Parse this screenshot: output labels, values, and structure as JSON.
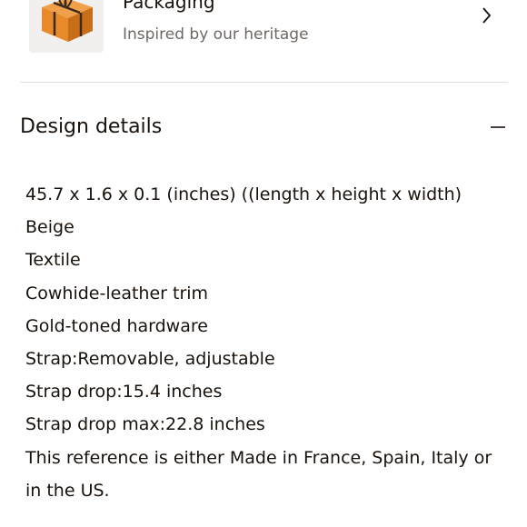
{
  "packaging": {
    "title": "Packaging",
    "subtitle": "Inspired by our heritage",
    "thumbnail_icon": "orange-gift-box-icon",
    "chevron_icon": "chevron-right-icon"
  },
  "design_details": {
    "title": "Design details",
    "toggle_icon": "minus-icon",
    "expanded": true,
    "items": [
      "45.7 x 1.6 x 0.1 (inches) ((length x height x width)",
      "Beige",
      "Textile",
      "Cowhide-leather trim",
      "Gold-toned hardware",
      "Strap:Removable, adjustable",
      "Strap drop:15.4 inches",
      "Strap drop max:22.8 inches",
      "This reference is either Made in France, Spain, Italy or in the US."
    ]
  },
  "colors": {
    "text": "#19110b",
    "muted_text": "#6d6864",
    "divider": "#e1dfdc",
    "box_orange": "#e8892a"
  }
}
